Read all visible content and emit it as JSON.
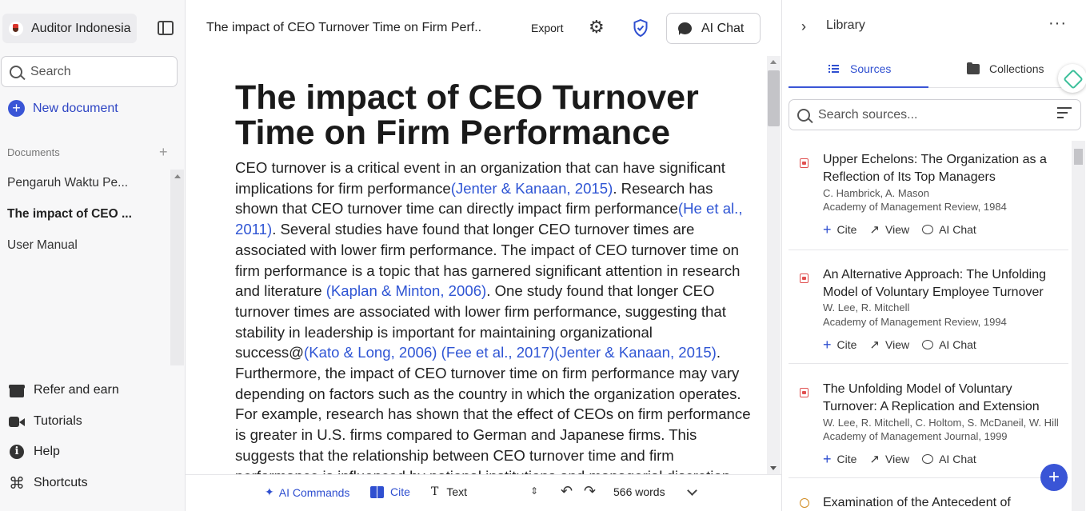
{
  "sidebar": {
    "workspace_name": "Auditor Indonesia",
    "search_placeholder": "Search",
    "new_document": "New document",
    "documents_header": "Documents",
    "documents": [
      {
        "label": "Pengaruh Waktu Pe..."
      },
      {
        "label": "The impact of CEO ..."
      },
      {
        "label": "User Manual"
      }
    ],
    "bottom": {
      "refer": "Refer and earn",
      "tutorials": "Tutorials",
      "help": "Help",
      "shortcuts": "Shortcuts"
    }
  },
  "topbar": {
    "doc_title": "The impact of CEO Turnover Time on Firm Perf...",
    "export": "Export",
    "ai_chat": "AI Chat"
  },
  "document": {
    "title": "The impact of CEO Turnover Time on Firm Performance",
    "body": [
      {
        "t": "CEO turnover is a critical event in an organization that can have significant implications for firm performance"
      },
      {
        "c": "(Jenter & Kanaan, 2015)"
      },
      {
        "t": ". Research has shown that CEO turnover time can directly impact firm performance"
      },
      {
        "c": "(He et al., 2011)"
      },
      {
        "t": ". Several studies have found that longer CEO turnover times are associated with lower firm performance. The impact of CEO turnover time on firm performance is a topic that has garnered significant attention in research and literature "
      },
      {
        "c": "(Kaplan & Minton, 2006)"
      },
      {
        "t": ". One study found that longer CEO turnover times are associated with lower firm performance, suggesting that stability in leadership is important for maintaining organizational success@"
      },
      {
        "c": "(Kato & Long, 2006)"
      },
      {
        "t": " "
      },
      {
        "c": "(Fee et al., 2017)"
      },
      {
        "c": "(Jenter & Kanaan, 2015)"
      },
      {
        "t": ". Furthermore, the impact of CEO turnover time on firm performance may vary depending on factors such as the country in which the organization operates. For example, research has shown that the effect of CEOs on firm performance is greater in U.S. firms compared to German and Japanese firms. This suggests that the relationship between CEO turnover time and firm performance is influenced by national institutions and managerial discretion."
      }
    ]
  },
  "bottom_toolbar": {
    "ai_commands": "AI Commands",
    "cite": "Cite",
    "text_style": "Text",
    "word_count": "566 words"
  },
  "library": {
    "title": "Library",
    "tabs": {
      "sources": "Sources",
      "collections": "Collections"
    },
    "search_placeholder": "Search sources...",
    "sources": [
      {
        "title": "Upper Echelons: The Organization as a Reflection of Its Top Managers",
        "authors": "C. Hambrick, A. Mason",
        "journal": "Academy of Management Review, 1984"
      },
      {
        "title": "An Alternative Approach: The Unfolding Model of Voluntary Employee Turnover",
        "authors": "W. Lee, R. Mitchell",
        "journal": "Academy of Management Review, 1994"
      },
      {
        "title": "The Unfolding Model of Voluntary Turnover: A Replication and Extension",
        "authors": "W. Lee, R. Mitchell, C. Holtom, S. McDaneil, W. Hill",
        "journal": "Academy of Management Journal, 1999"
      }
    ],
    "actions": {
      "cite": "Cite",
      "view": "View",
      "ai_chat": "AI Chat"
    },
    "partial_source_title": "Examination of the Antecedent of"
  },
  "colors": {
    "accent": "#3a55d6",
    "citation": "#2f55d4"
  }
}
